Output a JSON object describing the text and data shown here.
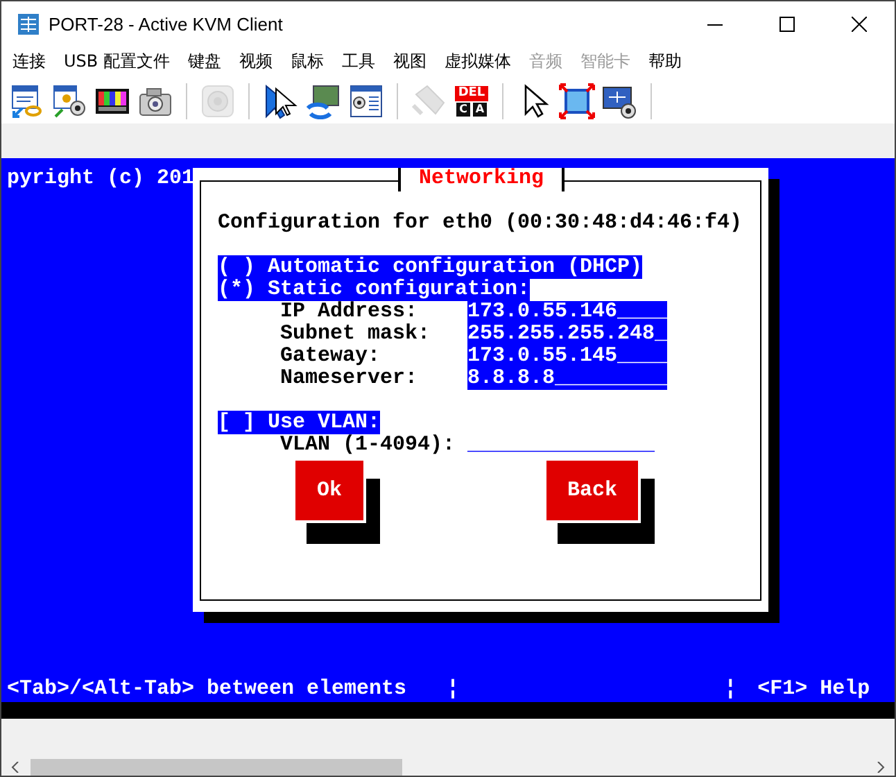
{
  "window": {
    "title": "PORT-28 - Active KVM Client"
  },
  "menu": [
    {
      "label": "连接",
      "disabled": false
    },
    {
      "label": "USB 配置文件",
      "disabled": false
    },
    {
      "label": "键盘",
      "disabled": false
    },
    {
      "label": "视频",
      "disabled": false
    },
    {
      "label": "鼠标",
      "disabled": false
    },
    {
      "label": "工具",
      "disabled": false
    },
    {
      "label": "视图",
      "disabled": false
    },
    {
      "label": "虚拟媒体",
      "disabled": false
    },
    {
      "label": "音频",
      "disabled": true
    },
    {
      "label": "智能卡",
      "disabled": true
    },
    {
      "label": "帮助",
      "disabled": false
    }
  ],
  "toolbar": [
    {
      "kind": "connect",
      "disabled": false
    },
    {
      "kind": "profile",
      "disabled": false
    },
    {
      "kind": "colorbars",
      "disabled": false
    },
    {
      "kind": "camera",
      "disabled": false
    },
    {
      "kind": "separator"
    },
    {
      "kind": "speaker",
      "disabled": true
    },
    {
      "kind": "separator"
    },
    {
      "kind": "cursor",
      "disabled": false
    },
    {
      "kind": "display",
      "disabled": false
    },
    {
      "kind": "computer",
      "disabled": false
    },
    {
      "kind": "separator"
    },
    {
      "kind": "plug",
      "disabled": true
    },
    {
      "kind": "keys",
      "disabled": false,
      "label": "DEL",
      "keys": [
        "C",
        "A"
      ]
    },
    {
      "kind": "separator"
    },
    {
      "kind": "pointer",
      "disabled": false
    },
    {
      "kind": "fullscreen",
      "disabled": false
    },
    {
      "kind": "scaling",
      "disabled": false
    },
    {
      "kind": "separator"
    }
  ],
  "console": {
    "background_line": "pyright (c) 201",
    "dialog": {
      "title": "Networking",
      "heading": "Configuration for eth0 (00:30:48:d4:46:f4)",
      "options": [
        {
          "text": "( ) Automatic configuration (DHCP)"
        },
        {
          "text": "(*) Static configuration:"
        }
      ],
      "fields": [
        {
          "label": "IP Address:",
          "value": "173.0.55.146____",
          "disabled": false
        },
        {
          "label": "Subnet mask:",
          "value": "255.255.255.248_",
          "disabled": false
        },
        {
          "label": "Gateway:",
          "value": "173.0.55.145____",
          "disabled": false
        },
        {
          "label": "Nameserver:",
          "value": "8.8.8.8_________",
          "disabled": false
        }
      ],
      "vlan_checkbox": "[ ] Use VLAN:",
      "vlan_field": {
        "label": "VLAN (1-4094):",
        "value": "_______________",
        "disabled": true
      },
      "buttons": [
        "Ok",
        "Back"
      ]
    },
    "status_bar": {
      "left": "<Tab>/<Alt-Tab> between elements",
      "divider_1": "¦",
      "divider_2": "¦",
      "right": "<F1> Help"
    }
  }
}
